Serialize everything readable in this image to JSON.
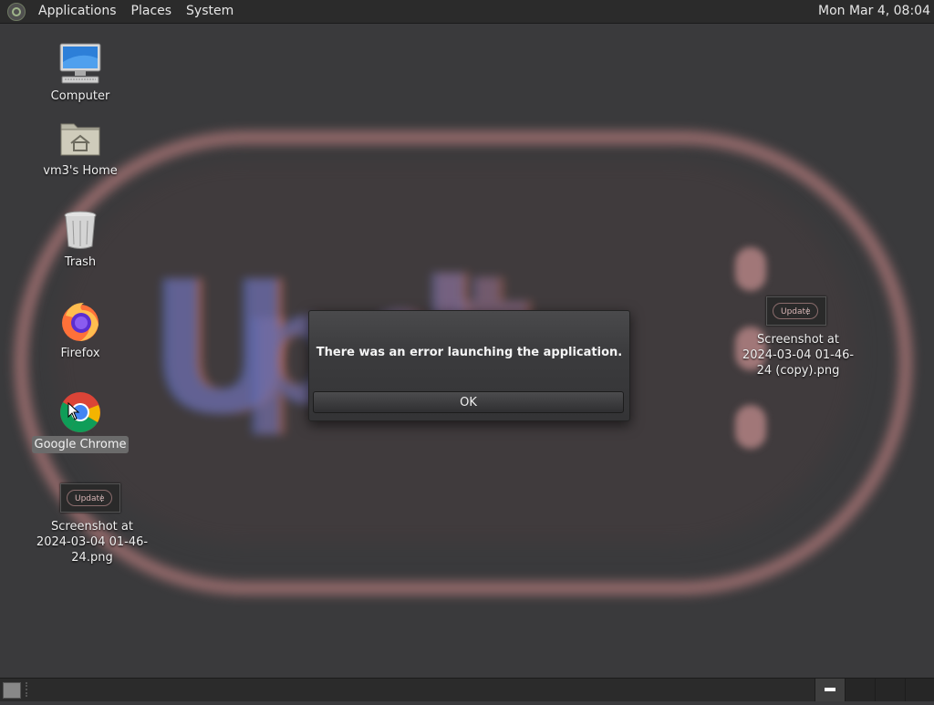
{
  "top_panel": {
    "menus": [
      "Applications",
      "Places",
      "System"
    ],
    "clock": "Mon Mar  4, 08:04"
  },
  "desktop": {
    "icons": [
      {
        "label": "Computer",
        "icon": "computer-icon"
      },
      {
        "label": "vm3's Home",
        "icon": "home-folder-icon"
      },
      {
        "label": "Trash",
        "icon": "trash-icon"
      },
      {
        "label": "Firefox",
        "icon": "firefox-icon"
      },
      {
        "label": "Google Chrome",
        "icon": "chrome-icon",
        "selected": true
      },
      {
        "label": "Screenshot at 2024-03-04 01-46-24.png",
        "icon": "image-file-icon",
        "thumb_text": "Update"
      },
      {
        "label": "Screenshot at 2024-03-04 01-46-24 (copy).png",
        "icon": "image-file-icon",
        "thumb_text": "Update"
      }
    ]
  },
  "dialog": {
    "message": "There was an error launching the application.",
    "ok_label": "OK"
  },
  "wallpaper": {
    "text": "Update",
    "colors": {
      "ring": "#e69696",
      "letters_blue": "#4a6cb0",
      "letters_red": "#c86a5a"
    }
  },
  "colors": {
    "panel": "#2b2b2b",
    "desktop": "#3a3a3c",
    "selection": "#6b6b6b"
  }
}
